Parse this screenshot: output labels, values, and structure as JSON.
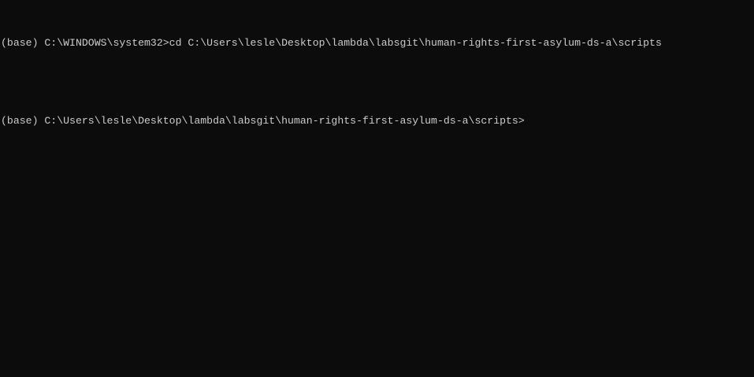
{
  "terminal": {
    "lines": [
      "(base) C:\\WINDOWS\\system32>cd C:\\Users\\lesle\\Desktop\\lambda\\labsgit\\human-rights-first-asylum-ds-a\\scripts",
      "",
      "(base) C:\\Users\\lesle\\Desktop\\lambda\\labsgit\\human-rights-first-asylum-ds-a\\scripts>"
    ],
    "colors": {
      "background": "#0c0c0c",
      "text": "#cccccc"
    }
  }
}
